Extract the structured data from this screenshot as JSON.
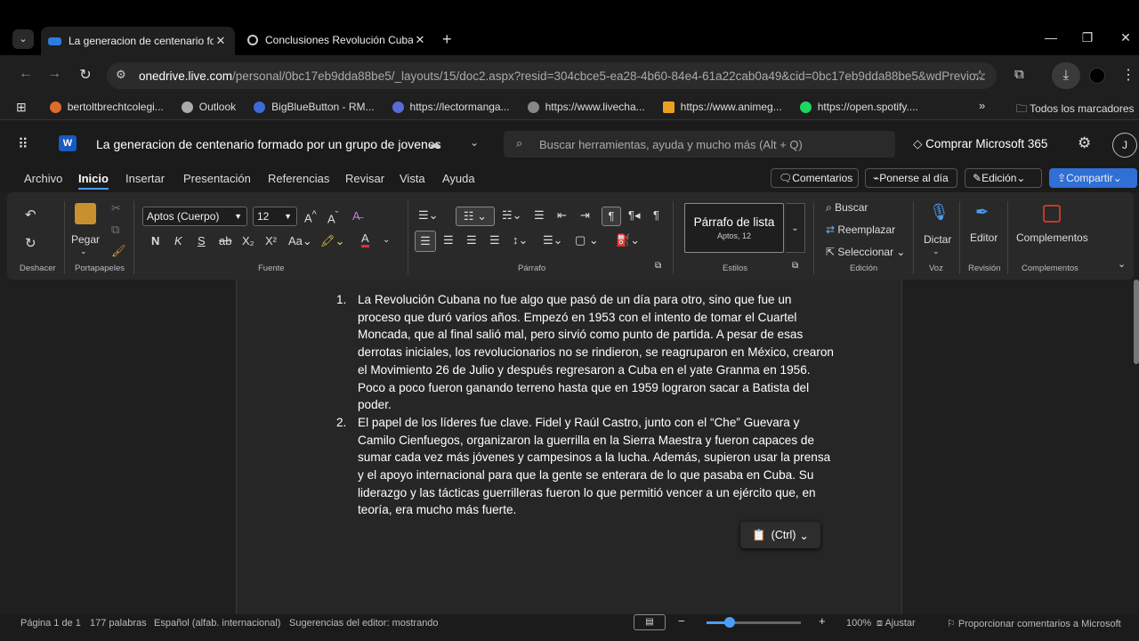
{
  "browser": {
    "tabs": [
      {
        "title": "La generacion de centenario fo",
        "active": true
      },
      {
        "title": "Conclusiones Revolución Cuban",
        "active": false
      }
    ],
    "address": {
      "host": "onedrive.live.com",
      "path": "/personal/0bc17eb9dda88be5/_layouts/15/doc2.aspx?resid=304cbce5-ea28-4b60-84e4-61a22cab0a49&cid=0bc17eb9dda88be5&wdPrevio..."
    },
    "bookmarks": [
      {
        "label": "bertoltbrechtcolegi...",
        "color": "#e06c2a"
      },
      {
        "label": "Outlook",
        "color": "#aaaaaa"
      },
      {
        "label": "BigBlueButton - RM...",
        "color": "#3b6bd6"
      },
      {
        "label": "https://lectormanga...",
        "color": "#5a6bd8"
      },
      {
        "label": "https://www.livecha...",
        "color": "#888888"
      },
      {
        "label": "https://www.animeg...",
        "color": "#e8a21f"
      },
      {
        "label": "https://open.spotify....",
        "color": "#1ed760"
      }
    ],
    "all_bookmarks": "Todos los marcadores"
  },
  "word": {
    "doc_title": "La generacion de centenario formado por un grupo de jovenes",
    "search_placeholder": "Buscar herramientas, ayuda y mucho más (Alt + Q)",
    "buy": "Comprar Microsoft 365",
    "avatar": "J",
    "menu": [
      "Archivo",
      "Inicio",
      "Insertar",
      "Presentación",
      "Referencias",
      "Revisar",
      "Vista",
      "Ayuda"
    ],
    "header_buttons": {
      "comments": "Comentarios",
      "catch_up": "Ponerse al día",
      "editing": "Edición",
      "share": "Compartir"
    },
    "ribbon": {
      "font_name": "Aptos (Cuerpo)",
      "font_size": "12",
      "paste": "Pegar",
      "style_name": "Párrafo de lista",
      "style_sub": "Aptos, 12",
      "find": "Buscar",
      "replace": "Reemplazar",
      "select": "Seleccionar",
      "dictate": "Dictar",
      "editor": "Editor",
      "addins": "Complementos",
      "groups": {
        "undo": "Deshacer",
        "clipboard": "Portapapeles",
        "font": "Fuente",
        "paragraph": "Párrafo",
        "styles": "Estilos",
        "editing": "Edición",
        "voice": "Voz",
        "review": "Revisión",
        "addins": "Complementos"
      }
    },
    "document": {
      "items": [
        {
          "num": "1.",
          "text": "La Revolución Cubana no fue algo que pasó de un día para otro, sino que fue un proceso que duró varios años. Empezó en 1953 con el intento de tomar el Cuartel Moncada, que al final salió mal, pero sirvió como punto de partida. A pesar de esas derrotas iniciales, los revolucionarios no se rindieron, se reagruparon en México, crearon el Movimiento 26 de Julio y después regresaron a Cuba en el yate Granma en 1956. Poco a poco fueron ganando terreno hasta que en 1959 lograron sacar a Batista del poder."
        },
        {
          "num": "2.",
          "text": "El papel de los líderes fue clave. Fidel y Raúl Castro, junto con el “Che” Guevara y Camilo Cienfuegos, organizaron la guerrilla en la Sierra Maestra y fueron capaces de sumar cada vez más jóvenes y campesinos a la lucha. Además, supieron usar la prensa y el apoyo internacional para que la gente se enterara de lo que pasaba en Cuba. Su liderazgo y las tácticas guerrilleras fueron lo que permitió vencer a un ejército que, en teoría, era mucho más fuerte."
        }
      ],
      "paste_options": "(Ctrl)"
    },
    "status": {
      "page": "Página 1 de 1",
      "words": "177 palabras",
      "language": "Español (alfab. internacional)",
      "editor": "Sugerencias del editor: mostrando",
      "zoom": "100%",
      "fit": "Ajustar",
      "feedback": "Proporcionar comentarios a Microsoft"
    }
  },
  "colors": {
    "accent": "#4a9ff5",
    "share_bg": "#2f6fd6",
    "word_blue": "#185abd"
  }
}
